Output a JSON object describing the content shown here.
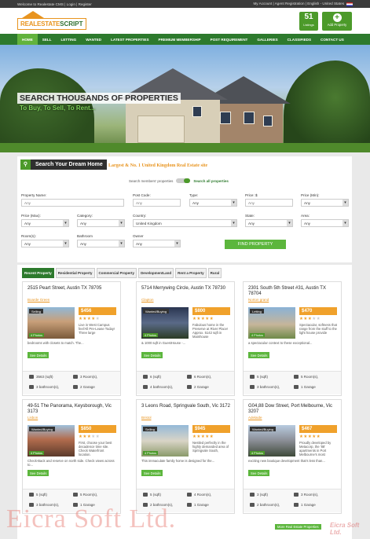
{
  "topbar": {
    "left": "Welcome to Realestate CMS | Login | Register",
    "right": "My Account | Agent Registration | English - United States"
  },
  "header": {
    "logo_part1": "REALESTATE",
    "logo_part2": "SCRIPT",
    "listings_count": "51",
    "listings_label": "Listings",
    "add_property_label": "Add Property"
  },
  "nav": {
    "items": [
      "HOME",
      "SELL",
      "LETTING",
      "WANTED",
      "LATEST PROPERTIES",
      "PREMIUM MEMBERSHIP",
      "POST REQUIREMENT",
      "GALLERIES",
      "CLASSIFIEDS",
      "CONTACT US"
    ]
  },
  "hero": {
    "headline": "SEARCH THOUSANDS OF PROPERTIES",
    "subline": "To Buy, To Sell, To Rent..."
  },
  "search": {
    "title": "Search Your Dream Home",
    "tagline": "Largest & No. 1 United Kingdom Real Estate site",
    "toggle_left": "Search members' properties",
    "toggle_right": "Search all properties",
    "labels": {
      "property_name": "Property Name:",
      "post_code": "Post Code:",
      "type": "Type:",
      "price_min": "Price: $",
      "price_min2": "Price (Min):",
      "price_max": "Price (Max):",
      "category": "Category:",
      "country": "Country:",
      "state": "State:",
      "area": "Area:",
      "rooms": "Room(s):",
      "bathroom": "Bathroom",
      "owner": "Owner"
    },
    "placeholders": {
      "property_name": "Any",
      "post_code": "Any",
      "price": "Any"
    },
    "values": {
      "type": "Any",
      "price_min2": "Any",
      "price_max": "Any",
      "category": "Any",
      "country": "United Kingdom",
      "state": "Any",
      "area": "Any",
      "rooms": "Any",
      "bathroom": "Any",
      "owner": "Any"
    },
    "find_button": "FIND PROPERTY"
  },
  "tabs": [
    "Recent Property",
    "Residential Property",
    "Commercial Property",
    "DevelopmentLand",
    "Rent a Property",
    "Rural"
  ],
  "cards": [
    {
      "address": "2515 Peart Street, Austin TX 78705",
      "city": "Boarde Green",
      "badge": "Selling",
      "photos": "4 Photos",
      "price": "$456",
      "stars_full": "★★★★",
      "stars_empty": "★",
      "desc": "Live in West Campus feel'All Pre-Lease Today! Three large",
      "desc2": "bedrooms with closets to match. The...",
      "details": "See Details",
      "sqft": "3563 (sqft)",
      "rooms": "3 Room(s),",
      "baths": "3 bathroom(s),",
      "garage": "2 Garage"
    },
    {
      "address": "5714 Merrywing Circle, Austin TX 78730",
      "city": "Clapton",
      "badge": "Wanted/Buying",
      "photos": "4 Photos",
      "price": "$800",
      "stars_full": "★★★★★",
      "stars_empty": "",
      "desc": "Fabulous home in the Preserve at River Place! Approx. 5142 sqft in Mainhouse",
      "desc2": "& 1000 sqft in GuestHouse -...",
      "details": "See Details",
      "sqft": "6 (sqft)",
      "rooms": "6 Room(s),",
      "baths": "4 bathroom(s),",
      "garage": "2 Garage"
    },
    {
      "address": "2301 South 5th Street #31, Austin TX 78704",
      "city": "Norton grand",
      "badge": "Letting",
      "photos": "4 Photos",
      "price": "$470",
      "stars_full": "★★★",
      "stars_empty": "★★",
      "desc": "Spectacular, softness that range from the stuff to the light house provide",
      "desc2": "a spectacular context to these exceptional...",
      "details": "See Details",
      "sqft": "5 (sqft)",
      "rooms": "5 Room(s),",
      "baths": "3 bathroom(s),",
      "garage": "1 Garage"
    },
    {
      "address": "49-51 The Panorama, Keysborough, Vic 3173",
      "city": "Lisbon",
      "badge": "Wanted/Buying",
      "photos": "4 Photos",
      "price": "$850",
      "stars_full": "★★★",
      "stars_empty": "★★",
      "desc": "First, choose your best decadence time site. Check Waterfront location.",
      "desc2": "Check-Back and reserve on north side. Check views across to...",
      "details": "See Details",
      "sqft": "5 (sqft)",
      "rooms": "5 Room(s),",
      "baths": "3 bathroom(s),",
      "garage": "1 Garage"
    },
    {
      "address": "3 Leons Road, Springvale South, Vic 3172",
      "city": "Bristol",
      "badge": "Selling",
      "photos": "4 Photos",
      "price": "$945",
      "stars_full": "★★★★★",
      "stars_empty": "",
      "desc": "Nestled perfectly in the highly demanded area of Springvale South,",
      "desc2": "This immaculate family home is designed for the...",
      "details": "See Details",
      "sqft": "5 (sqft)",
      "rooms": "4 Room(s),",
      "baths": "2 bathroom(s),",
      "garage": "1 Garage"
    },
    {
      "address": "G04,88 Dow Street, Port Melbourne, Vic 3207",
      "city": "Adelaide",
      "badge": "Wanted/Buying",
      "photos": "4 Photos",
      "price": "$467",
      "stars_full": "★★★★★",
      "stars_empty": "",
      "desc": "Proudly developed by Metacorp, the '88' apartments in Port Melbourne's most",
      "desc2": "exciting new boutique development that's less than...",
      "details": "See Details",
      "sqft": "3 (sqft)",
      "rooms": "3 Room(s),",
      "baths": "2 bathroom(s),",
      "garage": "1 Garage"
    }
  ],
  "more_link": "More Real Estate Properties",
  "watermark": "Eicra Soft Ltd.",
  "watermark_logo": "Eicra Soft Ltd.",
  "colors": {
    "brand_green": "#2d7a2d",
    "accent_orange": "#e8941f",
    "button_green": "#5cb63d"
  }
}
